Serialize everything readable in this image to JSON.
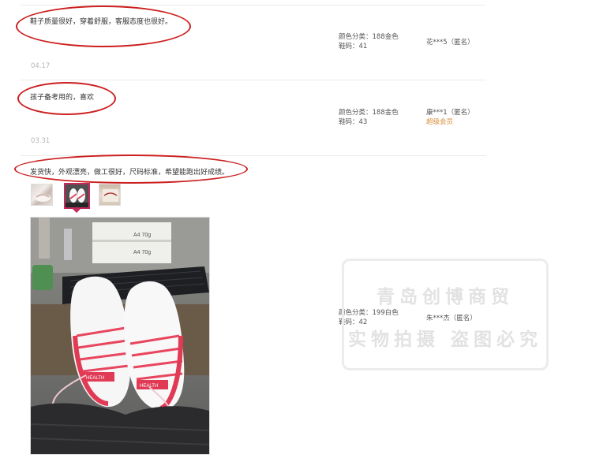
{
  "reviews": [
    {
      "comment": "鞋子质量很好，穿着舒服，客服态度也很好。",
      "color_label": "颜色分类：188金色",
      "size_label": "鞋码：41",
      "user": "花***5（匿名）",
      "member": "",
      "date": "04.17"
    },
    {
      "comment": "孩子备考用的，喜欢",
      "color_label": "颜色分类：188金色",
      "size_label": "鞋码：43",
      "user": "康***1（匿名）",
      "member": "超级会员",
      "date": "03.31"
    },
    {
      "comment": "发货快，外观漂亮，做工很好，尺码标准，希望能跑出好成绩。",
      "color_label": "颜色分类：199白色",
      "size_label": "鞋码：42",
      "user": "朱***杰（匿名）",
      "member": "",
      "date": ""
    }
  ],
  "watermark": {
    "line1": "青岛创博商贸",
    "line2": "实物拍摄 盗图必究"
  },
  "colors": {
    "highlight_circle": "#cc1f1f",
    "thumb_active_border": "#c22a5a",
    "member_badge": "#d88c3a",
    "date_text": "#b5b5b5"
  },
  "icons": [
    "review-photo-thumbnail",
    "shoe-photo"
  ]
}
